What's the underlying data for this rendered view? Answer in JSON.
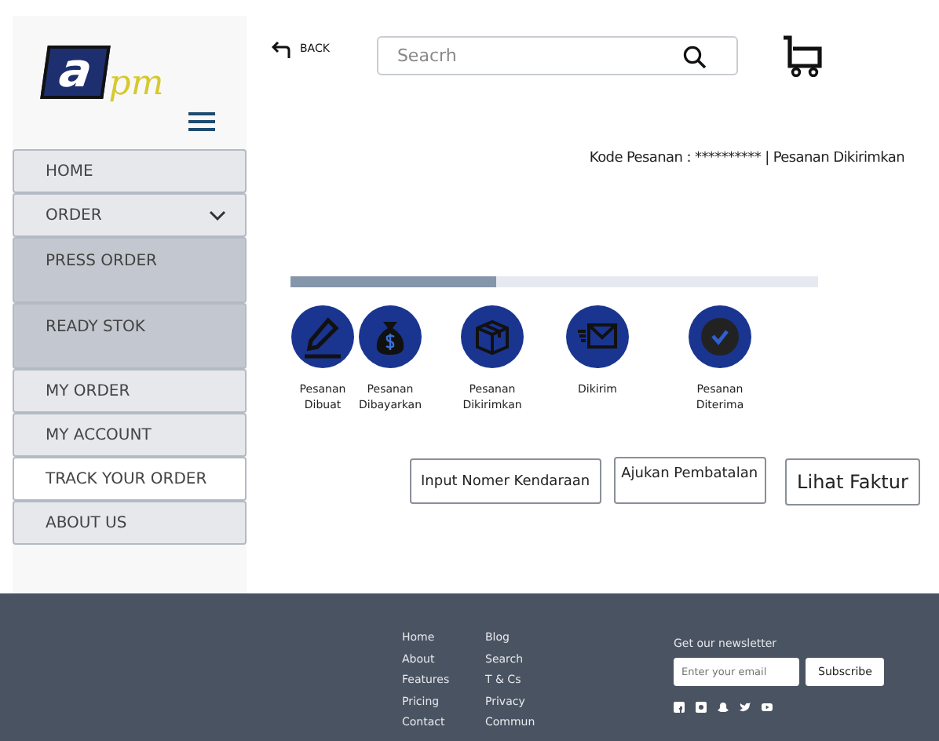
{
  "sidebar": {
    "logo": {
      "letter": "a",
      "text": "pm"
    },
    "items": [
      {
        "label": "HOME",
        "selected": false
      },
      {
        "label": "ORDER",
        "selected": false,
        "expanded": true,
        "children": [
          {
            "label": "PRESS ORDER",
            "selected": false
          },
          {
            "label": "READY STOK",
            "selected": false
          }
        ]
      },
      {
        "label": "MY ORDER",
        "selected": false
      },
      {
        "label": "MY ACCOUNT",
        "selected": false
      },
      {
        "label": "TRACK YOUR ORDER",
        "selected": true
      },
      {
        "label": "ABOUT US",
        "selected": false
      }
    ]
  },
  "header": {
    "back": "BACK",
    "search": {
      "placeholder": "Seacrh"
    }
  },
  "order_status": "Kode Pesanan : ********** | Pesanan Dikirimkan",
  "progress": {
    "level": 0.39
  },
  "steps": [
    {
      "kind": "pencil",
      "label": "Pesanan Dibuat"
    },
    {
      "kind": "moneybag",
      "label": "Pesanan Dibayarkan"
    },
    {
      "kind": "box",
      "label": "Pesanan Dikirimkan"
    },
    {
      "kind": "mail",
      "label": "Dikirim"
    },
    {
      "kind": "check",
      "label": "Pesanan Diterima"
    }
  ],
  "buttons": [
    "Input Nomer Kendaraan",
    "Ajukan Pembatalan",
    "Lihat Faktur"
  ],
  "footer": {
    "links": [
      [
        "Home",
        "About",
        "Features",
        "Pricing",
        "Contact"
      ],
      [
        "Blog",
        "Search",
        "T & Cs",
        "Privacy",
        "Commun"
      ]
    ],
    "newsletter": {
      "title": "Get our newsletter",
      "placeholder": "Enter your email",
      "button": "Subscribe"
    }
  }
}
